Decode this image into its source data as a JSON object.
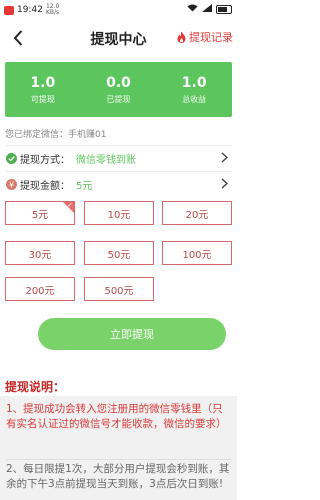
{
  "status_bar": {
    "time": "19:42",
    "speed_top": "12.0",
    "speed_unit": "KB/s",
    "battery": ""
  },
  "header": {
    "title": "提现中心",
    "record_label": "提现记录"
  },
  "stats": [
    {
      "value": "1.0",
      "label": "可提现"
    },
    {
      "value": "0.0",
      "label": "已提现"
    },
    {
      "value": "1.0",
      "label": "总收益"
    }
  ],
  "bound_account": "您已绑定微信：手机赚01",
  "method": {
    "label": "提现方式：",
    "value": "微信零钱到账"
  },
  "amount": {
    "label": "提现金额：",
    "value": "5元"
  },
  "options": [
    "5元",
    "10元",
    "20元",
    "30元",
    "50元",
    "100元",
    "200元",
    "500元"
  ],
  "selected_option": "5元",
  "submit_label": "立即提现",
  "notes": {
    "title": "提现说明：",
    "item1": "1、提现成功会转入您注册用的微信零钱里（只有实名认证过的微信号才能收款，微信的要求）",
    "item2": "2、每日限提1次，大部分用户提现会秒到账，其余的下午3点前提现当天到账，3点后次日到账!"
  },
  "colors": {
    "accent": "#5dc55d",
    "danger": "#d26a6a",
    "button": "#7ad36a"
  }
}
